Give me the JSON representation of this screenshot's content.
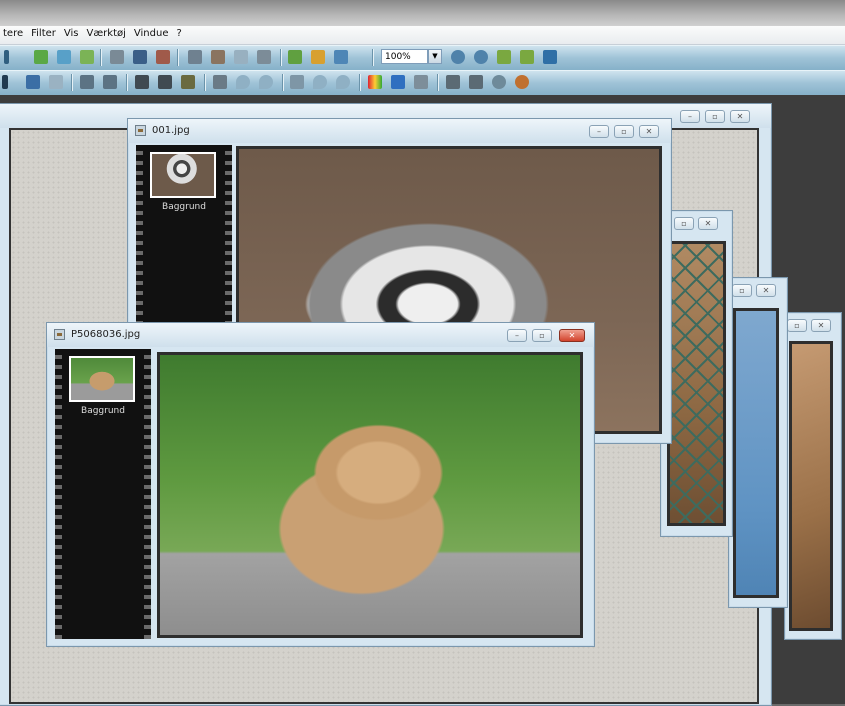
{
  "menu": {
    "items": [
      "tere",
      "Filter",
      "Vis",
      "Værktøj",
      "Vindue",
      "?"
    ]
  },
  "toolbar": {
    "zoom_value": "100%",
    "zoom_dropdown_glyph": "▼"
  },
  "windows": {
    "main_canvas": {
      "buttons": [
        "–",
        "▫",
        "✕"
      ]
    },
    "back_window_a": {
      "buttons": [
        "▫",
        "✕"
      ]
    },
    "back_window_b": {
      "buttons": [
        "▫",
        "✕"
      ]
    },
    "back_window_c": {
      "buttons": [
        "▫",
        "✕"
      ]
    },
    "lemur": {
      "title": "001.jpg",
      "layer_label": "Baggrund",
      "buttons": [
        "–",
        "▫",
        "✕"
      ]
    },
    "lion": {
      "title": "P5068036.jpg",
      "layer_label": "Baggrund",
      "buttons": [
        "–",
        "▫",
        "✕"
      ]
    }
  },
  "colors": {
    "toolbar_bg": "#9fc3d7",
    "window_frame": "#d6e6f1",
    "close_red": "#d2432c",
    "filmstrip": "#111111",
    "canvas_bg": "#d4d2cc"
  },
  "icons": {
    "toolbar_row1": [
      "layer-icon",
      "copy-icon",
      "paste-icon",
      "crop-icon",
      "frame-icon",
      "color-icon",
      "rotate-icon",
      "contrast-icon",
      "select-icon",
      "text-icon",
      "brush-icon",
      "bucket-icon",
      "image-icon",
      "zoom-in-icon",
      "zoom-out-icon",
      "fit-icon",
      "fit-width-icon",
      "fullscreen-icon"
    ],
    "toolbar_row2": [
      "arrow-icon",
      "mountain-icon",
      "lines-icon",
      "resize-icon",
      "resize2-icon",
      "film-icon",
      "film2-icon",
      "film3-icon",
      "brightness-icon",
      "drop-icon",
      "drop2-icon",
      "hill-icon",
      "drop3-icon",
      "drop4-icon",
      "palette-icon",
      "monitor-icon",
      "text2-icon",
      "film4-icon",
      "print-icon",
      "globe-icon",
      "web-icon"
    ]
  }
}
